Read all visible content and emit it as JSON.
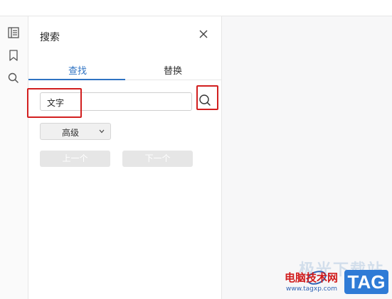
{
  "panel": {
    "title": "搜索",
    "tabs": [
      {
        "label": "查找",
        "active": true
      },
      {
        "label": "替换",
        "active": false
      }
    ],
    "search_input": {
      "value": "文字"
    },
    "advanced": {
      "label": "高级"
    },
    "buttons": {
      "prev": "上一个",
      "next": "下一个"
    }
  },
  "left_rail": {
    "icons": [
      "list-icon",
      "bookmark-icon",
      "search-icon"
    ]
  },
  "watermark": {
    "site_name": "电脑技术网",
    "url": "www.tagxp.com",
    "tag": "TAG",
    "faded_text": "极光下载站"
  },
  "colors": {
    "accent": "#2f73c3",
    "highlight_box": "#d21f1f",
    "tag_bg": "#2f7bd6"
  }
}
